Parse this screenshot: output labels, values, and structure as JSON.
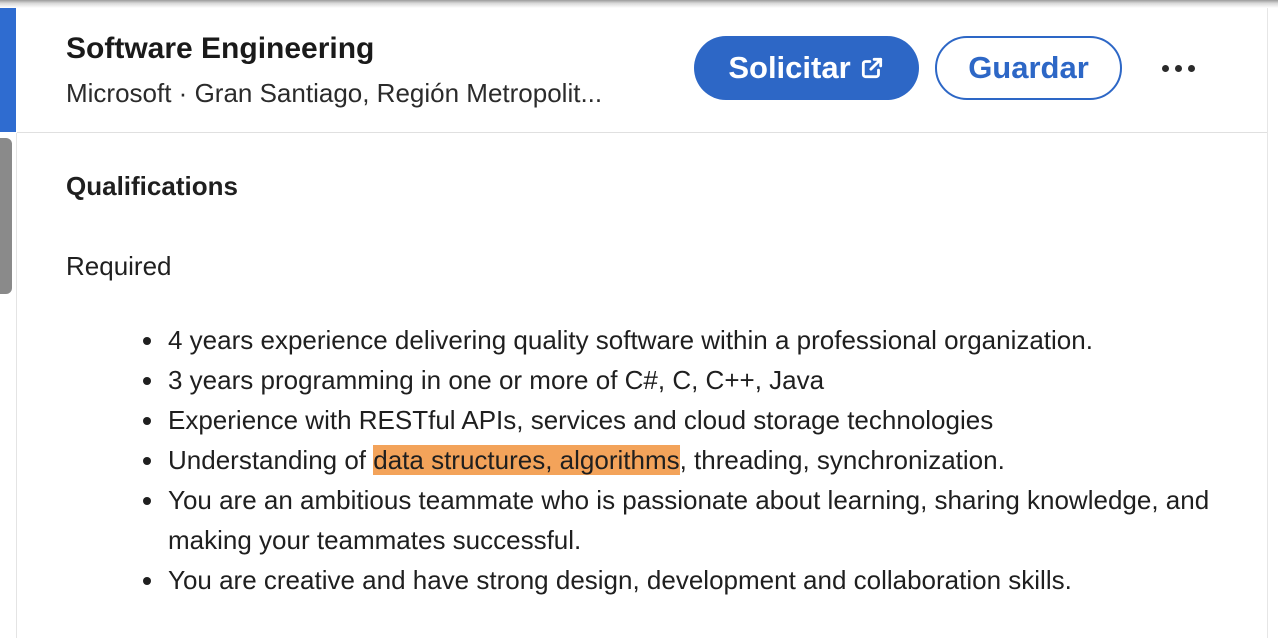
{
  "header": {
    "title": "Software Engineering",
    "meta": "Microsoft · Gran Santiago, Región Metropolit...",
    "apply_label": "Solicitar",
    "save_label": "Guardar"
  },
  "colors": {
    "accent": "#2d67c6",
    "highlight": "#f3a35a"
  },
  "content": {
    "section_title": "Qualifications",
    "required_label": "Required",
    "items": [
      {
        "text": "4 years experience delivering quality software within a professional organization."
      },
      {
        "text": "3 years programming in one or more of C#, C, C++, Java"
      },
      {
        "text": "Experience with RESTful APIs, services and cloud storage technologies"
      },
      {
        "before": "Understanding of ",
        "highlight": "data structures, algorithms",
        "after": ", threading, synchronization."
      },
      {
        "text": "You are an ambitious teammate who is passionate about learning, sharing knowledge, and making your teammates successful."
      },
      {
        "text": "You are creative and have strong design, development and collaboration skills."
      }
    ]
  },
  "icons": {
    "external_link": "external-link-icon",
    "more": "more-horizontal-icon"
  }
}
